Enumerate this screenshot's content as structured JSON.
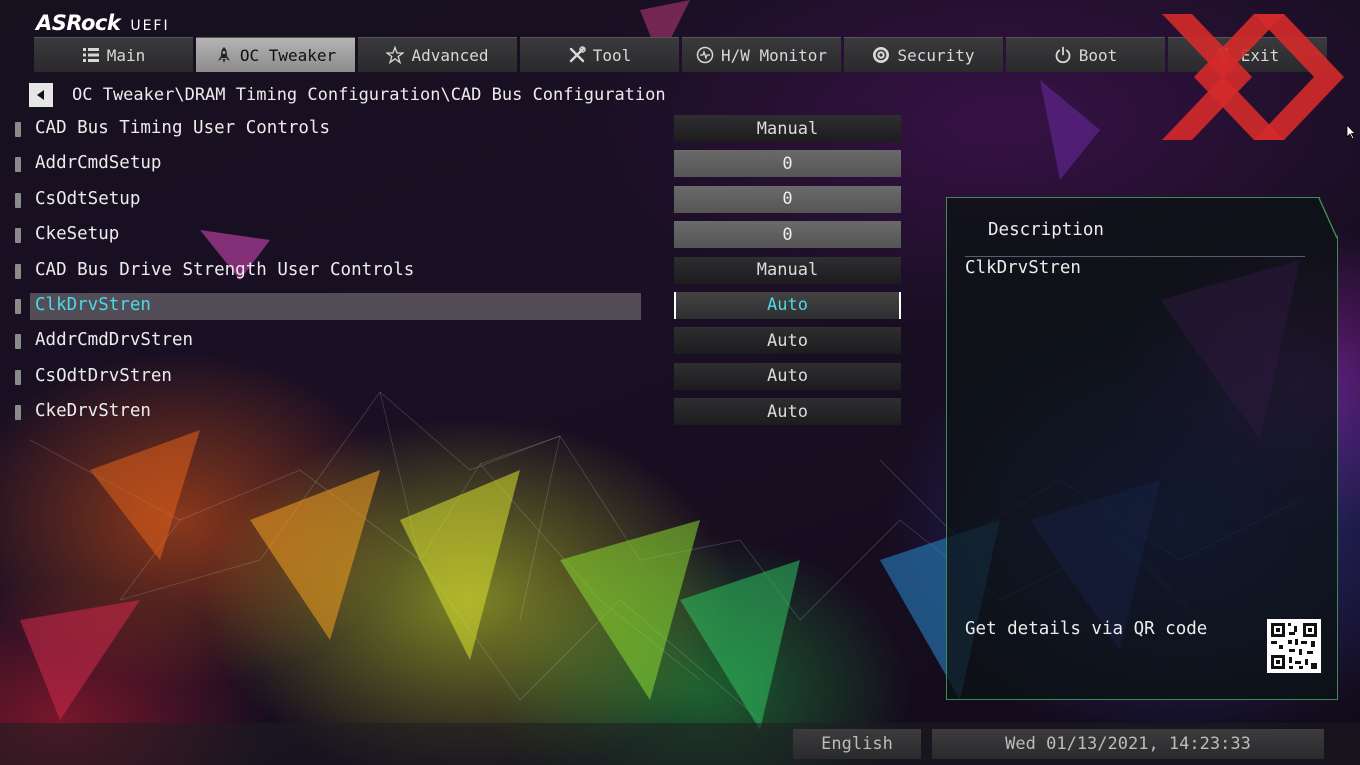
{
  "brand": {
    "name": "ASRock",
    "suffix": "UEFI"
  },
  "tabs": [
    {
      "label": "Main",
      "icon": "list-icon"
    },
    {
      "label": "OC Tweaker",
      "icon": "rocket-icon",
      "active": true
    },
    {
      "label": "Advanced",
      "icon": "star-icon"
    },
    {
      "label": "Tool",
      "icon": "tools-icon"
    },
    {
      "label": "H/W Monitor",
      "icon": "monitor-icon"
    },
    {
      "label": "Security",
      "icon": "shield-icon"
    },
    {
      "label": "Boot",
      "icon": "power-icon"
    },
    {
      "label": "Exit",
      "icon": "exit-icon"
    }
  ],
  "breadcrumb": "OC Tweaker\\DRAM Timing Configuration\\CAD Bus Configuration",
  "settings": [
    {
      "label": "CAD Bus Timing User Controls",
      "value": "Manual"
    },
    {
      "label": "AddrCmdSetup",
      "value": "0"
    },
    {
      "label": "CsOdtSetup",
      "value": "0"
    },
    {
      "label": "CkeSetup",
      "value": "0"
    },
    {
      "label": "CAD Bus Drive Strength User Controls",
      "value": "Manual"
    },
    {
      "label": "ClkDrvStren",
      "value": "Auto",
      "selected": true
    },
    {
      "label": "AddrCmdDrvStren",
      "value": "Auto"
    },
    {
      "label": "CsOdtDrvStren",
      "value": "Auto"
    },
    {
      "label": "CkeDrvStren",
      "value": "Auto"
    }
  ],
  "description": {
    "title": "Description",
    "text": "ClkDrvStren",
    "qr_label": "Get details via QR code"
  },
  "footer": {
    "language": "English",
    "datetime": "Wed 01/13/2021, 14:23:33"
  },
  "colors": {
    "highlight_text": "#4fd8e8",
    "panel_border": "#3e8a52",
    "watermark": "#d42a2a"
  }
}
